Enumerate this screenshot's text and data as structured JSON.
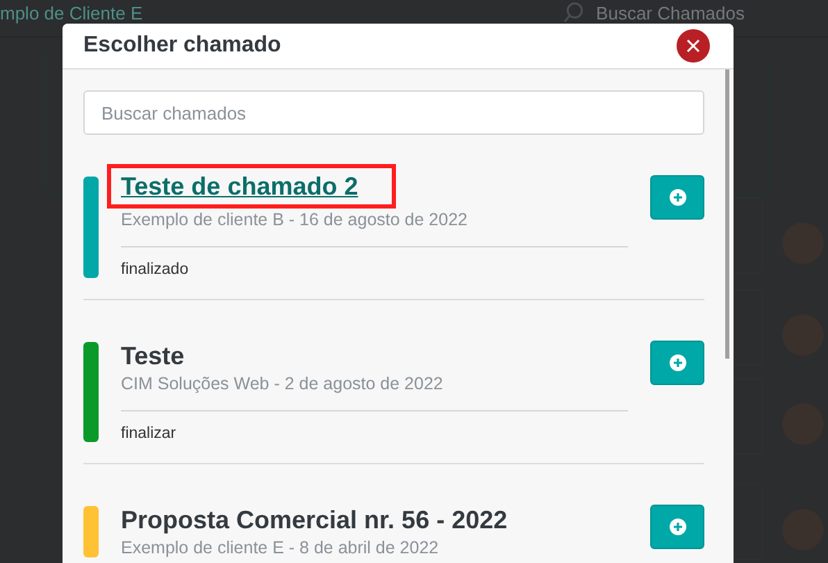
{
  "background": {
    "client_text": "mplo de Cliente E",
    "search_label": "Buscar Chamados"
  },
  "modal": {
    "title": "Escolher chamado",
    "search": {
      "placeholder": "Buscar chamados"
    },
    "items": [
      {
        "title": "Teste de chamado 2",
        "subtitle": "Exemplo de cliente B - 16 de agosto de 2022",
        "status": "finalizado",
        "color": "#00a8a8",
        "selected": true
      },
      {
        "title": "Teste",
        "subtitle": "CIM Soluções Web - 2 de agosto de 2022",
        "status": "finalizar",
        "color": "#0a9a2a",
        "selected": false
      },
      {
        "title": "Proposta Comercial nr. 56 - 2022",
        "subtitle": "Exemplo de cliente E - 8 de abril de 2022",
        "color": "#ffc234",
        "selected": false
      }
    ]
  }
}
